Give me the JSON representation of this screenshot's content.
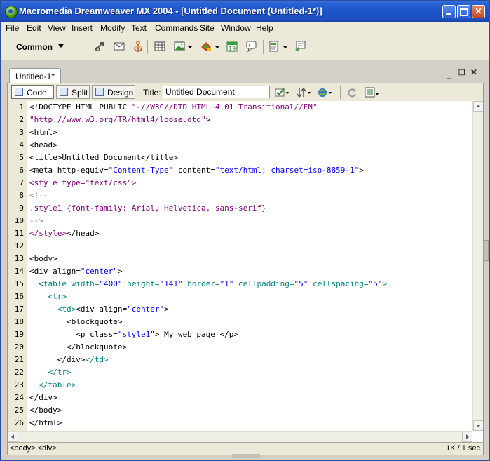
{
  "window": {
    "title": "Macromedia Dreamweaver MX 2004 - [Untitled Document (Untitled-1*)]"
  },
  "menu": [
    "File",
    "Edit",
    "View",
    "Insert",
    "Modify",
    "Text",
    "Commands",
    "Site",
    "Window",
    "Help"
  ],
  "insert_bar": {
    "category": "Common",
    "icons": [
      "hyperlink-icon",
      "email-link-icon",
      "named-anchor-icon",
      "table-icon",
      "image-icon",
      "media-icon",
      "date-icon",
      "comment-icon",
      "templates-icon",
      "tag-chooser-icon"
    ]
  },
  "document": {
    "tab_label": "Untitled-1*",
    "view_buttons": {
      "code": "Code",
      "split": "Split",
      "design": "Design"
    },
    "title_label": "Title:",
    "title_value": "Untitled Document"
  },
  "code": {
    "line_numbers": [
      "1",
      "2",
      "3",
      "4",
      "5",
      "6",
      "7",
      "8",
      "9",
      "10",
      "11",
      "12",
      "13",
      "14",
      "15",
      "16",
      "17",
      "18",
      "19",
      "20",
      "21",
      "22",
      "23",
      "24",
      "25",
      "26"
    ],
    "lines": [
      [
        {
          "t": "<!DOCTYPE HTML PUBLIC ",
          "c": "tk"
        },
        {
          "t": "\"-//W3C//DTD HTML 4.01 Transitional//EN\"",
          "c": "css"
        }
      ],
      [
        {
          "t": "\"http://www.w3.org/TR/html4/loose.dtd\"",
          "c": "css"
        },
        {
          "t": ">",
          "c": "tk"
        }
      ],
      [
        {
          "t": "<html>",
          "c": "tk"
        }
      ],
      [
        {
          "t": "<head>",
          "c": "tk"
        }
      ],
      [
        {
          "t": "<title>",
          "c": "tk"
        },
        {
          "t": "Untitled Document",
          "c": "txt"
        },
        {
          "t": "</title>",
          "c": "tk"
        }
      ],
      [
        {
          "t": "<meta http-equiv=",
          "c": "tk"
        },
        {
          "t": "\"Content-Type\"",
          "c": "av"
        },
        {
          "t": " content=",
          "c": "tk"
        },
        {
          "t": "\"text/html; charset=iso-8859-1\"",
          "c": "av"
        },
        {
          "t": ">",
          "c": "tk"
        }
      ],
      [
        {
          "t": "<style type=",
          "c": "css"
        },
        {
          "t": "\"text/css\"",
          "c": "css"
        },
        {
          "t": ">",
          "c": "css"
        }
      ],
      [
        {
          "t": "<!--",
          "c": "cm"
        }
      ],
      [
        {
          "t": ".style1 {font-family: Arial, Helvetica, sans-serif}",
          "c": "css"
        }
      ],
      [
        {
          "t": "-->",
          "c": "cm"
        }
      ],
      [
        {
          "t": "</style>",
          "c": "css"
        },
        {
          "t": "</head>",
          "c": "tk"
        }
      ],
      [],
      [
        {
          "t": "<body>",
          "c": "tk"
        }
      ],
      [
        {
          "t": "<div align=",
          "c": "tk"
        },
        {
          "t": "\"center\"",
          "c": "av"
        },
        {
          "t": ">",
          "c": "tk"
        }
      ],
      [
        {
          "t": "  <table width=",
          "c": "tb"
        },
        {
          "t": "\"400\"",
          "c": "av"
        },
        {
          "t": " height=",
          "c": "tb"
        },
        {
          "t": "\"141\"",
          "c": "av"
        },
        {
          "t": " border=",
          "c": "tb"
        },
        {
          "t": "\"1\"",
          "c": "av"
        },
        {
          "t": " cellpadding=",
          "c": "tb"
        },
        {
          "t": "\"5\"",
          "c": "av"
        },
        {
          "t": " cellspacing=",
          "c": "tb"
        },
        {
          "t": "\"5\"",
          "c": "av"
        },
        {
          "t": ">",
          "c": "tb"
        }
      ],
      [
        {
          "t": "    <tr>",
          "c": "tb"
        }
      ],
      [
        {
          "t": "      <td>",
          "c": "tb"
        },
        {
          "t": "<div align=",
          "c": "tk"
        },
        {
          "t": "\"center\"",
          "c": "av"
        },
        {
          "t": ">",
          "c": "tk"
        }
      ],
      [
        {
          "t": "        <blockquote>",
          "c": "tk"
        }
      ],
      [
        {
          "t": "          <p class=",
          "c": "tk"
        },
        {
          "t": "\"style1\"",
          "c": "av"
        },
        {
          "t": "> My web page </p>",
          "c": "tk"
        }
      ],
      [
        {
          "t": "        </blockquote>",
          "c": "tk"
        }
      ],
      [
        {
          "t": "      </div>",
          "c": "tk"
        },
        {
          "t": "</td>",
          "c": "tb"
        }
      ],
      [
        {
          "t": "    </tr>",
          "c": "tb"
        }
      ],
      [
        {
          "t": "  </table>",
          "c": "tb"
        }
      ],
      [
        {
          "t": "</div>",
          "c": "tk"
        }
      ],
      [
        {
          "t": "</body>",
          "c": "tk"
        }
      ],
      [
        {
          "t": "</html>",
          "c": "tk"
        }
      ]
    ]
  },
  "status": {
    "tag_selector": "<body> <div>",
    "size_time": "1K / 1 sec"
  }
}
